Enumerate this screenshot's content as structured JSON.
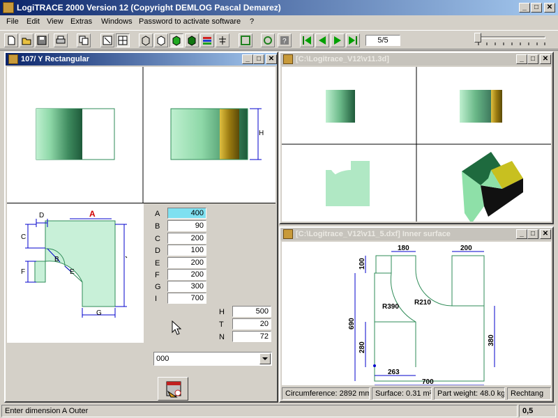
{
  "app": {
    "title": "LogiTRACE 2000  Version 12  (Copyright DEMLOG Pascal Demarez)",
    "window_min": "_",
    "window_max": "□",
    "window_close": "✕"
  },
  "menu": [
    "File",
    "Edit",
    "View",
    "Extras",
    "Windows",
    "Password to activate software",
    "?"
  ],
  "toolbar": {
    "page_counter": "5/5"
  },
  "win_left": {
    "title": "107/ Y Rectangular",
    "dims": {
      "labels": [
        "A",
        "B",
        "C",
        "D",
        "E",
        "F",
        "G",
        "I"
      ],
      "values": [
        "400",
        "90",
        "200",
        "100",
        "200",
        "200",
        "300",
        "700"
      ]
    },
    "extra": {
      "labels": [
        "H",
        "T",
        "N"
      ],
      "values": [
        "500",
        "20",
        "72"
      ]
    },
    "combo_value": "000",
    "sketch_labels": {
      "A": "A",
      "B": "B",
      "C": "C",
      "D": "D",
      "E": "E",
      "F": "F",
      "G": "G",
      "H": "H"
    }
  },
  "win_right_top": {
    "title": "[C:\\Logitrace_V12\\v11.3d]"
  },
  "win_right_bottom": {
    "title": "[C:\\Logitrace_V12\\v11_5.dxf]  Inner surface",
    "dims": {
      "top_left": "180",
      "top_right": "200",
      "left_small": "100",
      "left_big": "690",
      "left_bottom": "280",
      "right": "380",
      "bottom_inner": "263",
      "bottom": "700",
      "r1": "R390",
      "r2": "R210"
    },
    "status": {
      "circumference": "Circumference: 2892 mm",
      "surface": "Surface: 0.31 m²",
      "weight": "Part weight: 48.0 kg",
      "shape": "Rechtang"
    }
  },
  "status": {
    "message": "Enter dimension A Outer",
    "value": "0,5"
  }
}
